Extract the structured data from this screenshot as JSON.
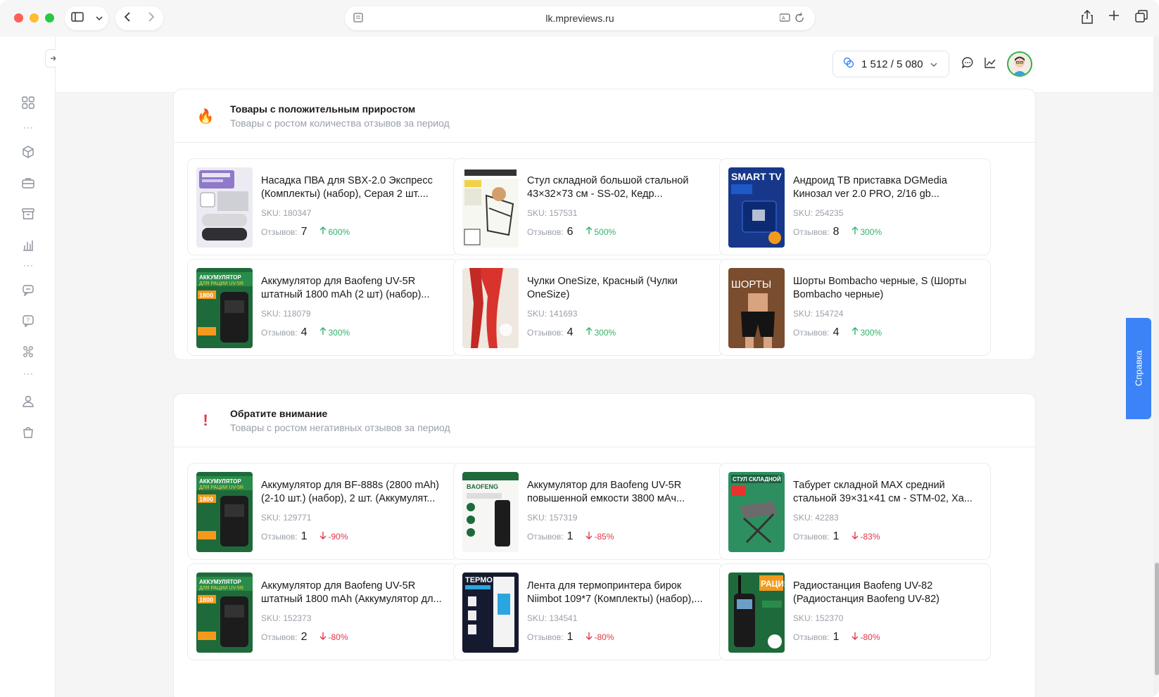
{
  "browser": {
    "url": "lk.mpreviews.ru",
    "traffic_colors": [
      "#fe5f57",
      "#febc2e",
      "#28c840"
    ]
  },
  "topbar": {
    "balance": "1 512 / 5 080",
    "balance_icon": "coins-icon",
    "chat_icon": "chat-icon",
    "chart_icon": "chart-line-icon"
  },
  "sidebar": {
    "items": [
      {
        "icon": "grid-icon"
      },
      {
        "icon": "cubes-icon"
      },
      {
        "icon": "briefcase-icon"
      },
      {
        "icon": "archive-icon"
      },
      {
        "icon": "bar-chart-icon"
      },
      {
        "icon": "messages-icon"
      },
      {
        "icon": "question-icon"
      },
      {
        "icon": "hierarchy-icon"
      },
      {
        "icon": "user-icon"
      },
      {
        "icon": "bag-icon"
      }
    ]
  },
  "help_label": "Справка",
  "sections": [
    {
      "icon": "🔥",
      "title": "Товары с положительным приростом",
      "subtitle": "Товары с ростом количества отзывов за период",
      "review_label": "Отзывов:",
      "products": [
        {
          "name": "Насадка ПВА для SBX-2.0 Экспресс (Комплекты) (набор), Серая 2 шт....",
          "sku": "SKU: 180347",
          "reviews": "7",
          "change": "600%",
          "dir": "up",
          "thumb": "sponge"
        },
        {
          "name": "Стул складной большой стальной 43×32×73 см - SS-02, Кедр...",
          "sku": "SKU: 157531",
          "reviews": "6",
          "change": "500%",
          "dir": "up",
          "thumb": "chair"
        },
        {
          "name": "Андроид ТВ приставка DGMedia Кинозал ver 2.0 PRO, 2/16 gb...",
          "sku": "SKU: 254235",
          "reviews": "8",
          "change": "300%",
          "dir": "up",
          "thumb": "tvbox"
        },
        {
          "name": "Аккумулятор для Baofeng UV-5R штатный 1800 mAh (2 шт) (набор)...",
          "sku": "SKU: 118079",
          "reviews": "4",
          "change": "300%",
          "dir": "up",
          "thumb": "battery"
        },
        {
          "name": "Чулки OneSize, Красный (Чулки OneSize)",
          "sku": "SKU: 141693",
          "reviews": "4",
          "change": "300%",
          "dir": "up",
          "thumb": "stockings"
        },
        {
          "name": "Шорты Bombacho черные, S (Шорты Bombacho черные)",
          "sku": "SKU: 154724",
          "reviews": "4",
          "change": "300%",
          "dir": "up",
          "thumb": "shorts"
        }
      ]
    },
    {
      "icon": "!",
      "title": "Обратите внимание",
      "subtitle": "Товары с ростом негативных отзывов за период",
      "review_label": "Отзывов:",
      "products": [
        {
          "name": "Аккумулятор для BF-888s (2800 mAh) (2-10 шт.) (набор), 2 шт. (Аккумулят...",
          "sku": "SKU: 129771",
          "reviews": "1",
          "change": "-90%",
          "dir": "down",
          "thumb": "battery"
        },
        {
          "name": "Аккумулятор для Baofeng UV-5R повышенной емкости 3800 мАч...",
          "sku": "SKU: 157319",
          "reviews": "1",
          "change": "-85%",
          "dir": "down",
          "thumb": "battery2"
        },
        {
          "name": "Табурет складной MAX средний стальной 39×31×41 см - STM-02, Ха...",
          "sku": "SKU: 42283",
          "reviews": "1",
          "change": "-83%",
          "dir": "down",
          "thumb": "stool"
        },
        {
          "name": "Аккумулятор для Baofeng UV-5R штатный 1800 mAh (Аккумулятор дл...",
          "sku": "SKU: 152373",
          "reviews": "2",
          "change": "-80%",
          "dir": "down",
          "thumb": "battery"
        },
        {
          "name": "Лента для термопринтера бирок Niimbot 109*7 (Комплекты) (набор),...",
          "sku": "SKU: 134541",
          "reviews": "1",
          "change": "-80%",
          "dir": "down",
          "thumb": "labels"
        },
        {
          "name": "Радиостанция Baofeng UV-82 (Радиостанция Baofeng UV-82)",
          "sku": "SKU: 152370",
          "reviews": "1",
          "change": "-80%",
          "dir": "down",
          "thumb": "radio"
        }
      ]
    }
  ]
}
